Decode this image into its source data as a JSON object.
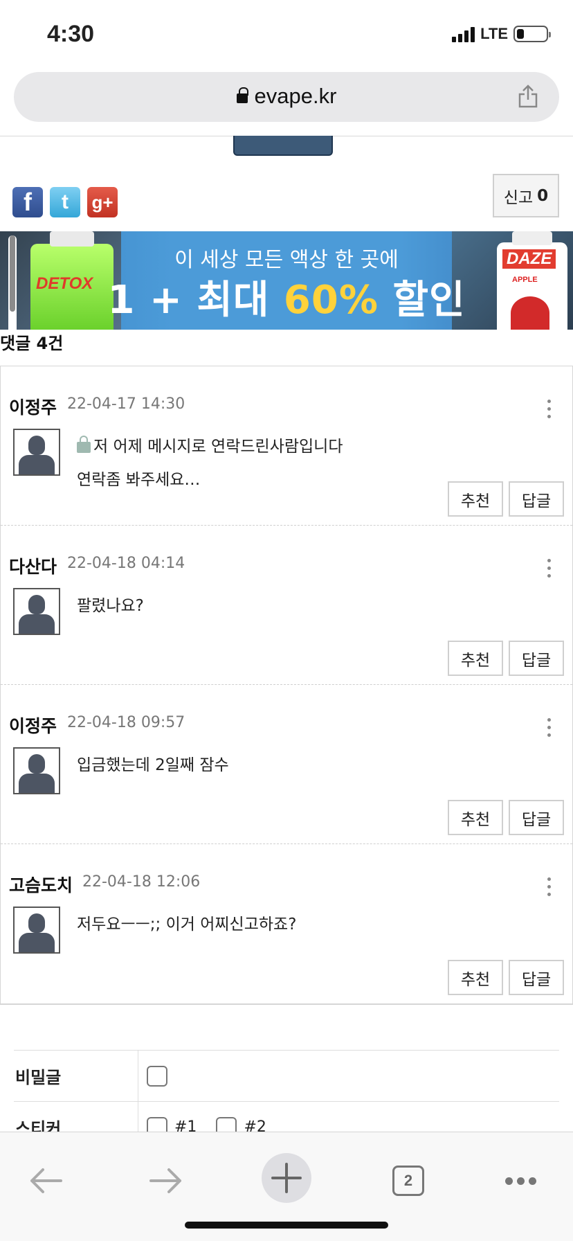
{
  "status_bar": {
    "time": "4:30",
    "network": "LTE"
  },
  "browser": {
    "url": "evape.kr",
    "tab_count": "2"
  },
  "share": {
    "facebook": "f",
    "twitter": "t",
    "google_plus": "g+"
  },
  "report": {
    "label": "신고",
    "count": "0"
  },
  "banner": {
    "line1": "이 세상 모든 액상 한 곳에",
    "line2_a": "1 + 최대 ",
    "line2_highlight": "60%",
    "line2_b": " 할인",
    "left_product": "DETOX",
    "right_product": "DAZE",
    "right_product_sub": "APPLE"
  },
  "comment_count_label": "댓글 4건",
  "comments": [
    {
      "author": "이정주",
      "date": "22-04-17 14:30",
      "secret": true,
      "lines": [
        "저 어제 메시지로 연락드린사람입니다",
        "연락좀 봐주세요…"
      ]
    },
    {
      "author": "다산다",
      "date": "22-04-18 04:14",
      "lines": [
        "팔렸나요?"
      ]
    },
    {
      "author": "이정주",
      "date": "22-04-18 09:57",
      "lines": [
        "입금했는데 2일째 잠수"
      ]
    },
    {
      "author": "고슴도치",
      "date": "22-04-18 12:06",
      "lines": [
        "저두요ㅡㅡ;; 이거 어찌신고하죠?"
      ]
    }
  ],
  "comment_buttons": {
    "recommend": "추천",
    "reply": "답글"
  },
  "form": {
    "secret_label": "비밀글",
    "sticker_label": "스티커",
    "sticker_opt1": "#1",
    "sticker_opt2": "#2"
  },
  "icons": {
    "back": "arrow-left-icon",
    "forward": "arrow-right-icon",
    "new_tab": "plus-icon",
    "tabs": "tabs-icon",
    "menu": "more-horizontal-icon"
  }
}
